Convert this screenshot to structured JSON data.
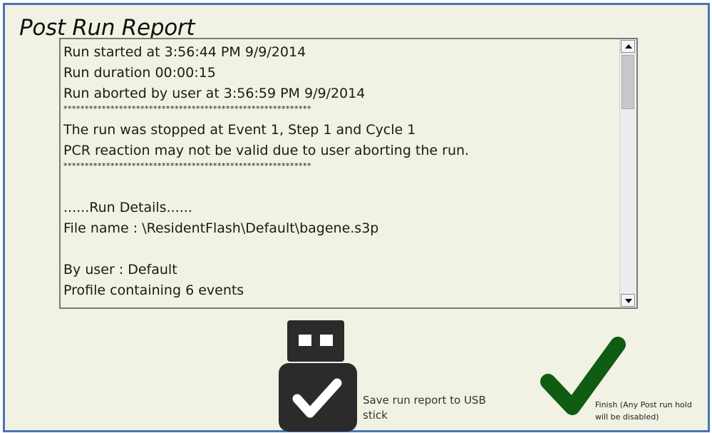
{
  "window": {
    "title": "Post Run Report"
  },
  "report": {
    "lines": [
      "Run started at 3:56:44 PM 9/9/2014",
      "Run duration 00:00:15",
      "Run aborted by user at 3:56:59 PM 9/9/2014",
      "**********************************************************",
      "The run was stopped at Event 1, Step 1 and Cycle 1",
      "PCR reaction may not be valid due to user aborting the run.",
      "**********************************************************",
      "......Run Details......",
      "File name : \\ResidentFlash\\Default\\bagene.s3p",
      "By user : Default",
      "Profile containing 6 events"
    ]
  },
  "actions": {
    "save_usb_label": "Save run report to USB stick",
    "finish_label": "Finish (Any Post run hold will be disabled)"
  },
  "icons": {
    "usb": "usb-stick-check-icon",
    "finish": "green-checkmark-icon"
  },
  "colors": {
    "window_border": "#4a74b5",
    "background": "#f1f2e3",
    "usb_icon": "#2b2b2b",
    "finish_check": "#0f5c12"
  }
}
